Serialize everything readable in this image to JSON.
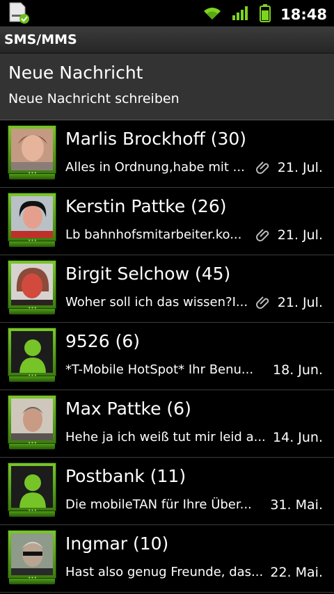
{
  "statusbar": {
    "time": "18:48",
    "notification_icon": "sd-card-done-icon",
    "wifi_icon": "wifi-icon",
    "signal_icon": "signal-icon",
    "battery_icon": "battery-icon",
    "accent": "#7ed321"
  },
  "titlebar": {
    "title": "SMS/MMS"
  },
  "compose": {
    "title": "Neue Nachricht",
    "subtitle": "Neue Nachricht schreiben"
  },
  "conversations": [
    {
      "name": "Marlis Brockhoff (30)",
      "snippet": "Alles in Ordnung,habe mit ...",
      "attachment": true,
      "date": "21. Jul."
    },
    {
      "name": "Kerstin Pattke (26)",
      "snippet": "Lb bahnhofsmitarbeiter.ko...",
      "attachment": true,
      "date": "21. Jul."
    },
    {
      "name": "Birgit Selchow (45)",
      "snippet": "Woher soll ich das wissen?I...",
      "attachment": true,
      "date": "21. Jul."
    },
    {
      "name": "9526 (6)",
      "snippet": "*T-Mobile HotSpot* Ihr Benu...",
      "attachment": false,
      "date": "18. Jun."
    },
    {
      "name": "Max Pattke (6)",
      "snippet": "Hehe ja ich weiß tut mir leid a...",
      "attachment": false,
      "date": "14. Jun."
    },
    {
      "name": "Postbank (11)",
      "snippet": "Die mobileTAN für Ihre Über...",
      "attachment": false,
      "date": "31. Mai."
    },
    {
      "name": "Ingmar (10)",
      "snippet": "Hast also genug Freunde, das...",
      "attachment": false,
      "date": "22. Mai."
    }
  ]
}
